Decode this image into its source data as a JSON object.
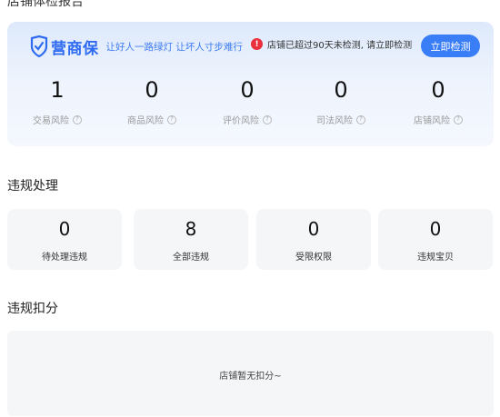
{
  "top_title": "店铺体检报告",
  "risk_panel": {
    "logo_text": "营商保",
    "slogan": "让好人一路绿灯 让坏人寸步难行",
    "alert_text": "店铺已超过90天未检测, 请立即检测",
    "alert_icon": "!",
    "detect_button": "立即检测",
    "items": [
      {
        "value": "1",
        "label": "交易风险"
      },
      {
        "value": "0",
        "label": "商品风险"
      },
      {
        "value": "0",
        "label": "评价风险"
      },
      {
        "value": "0",
        "label": "司法风险"
      },
      {
        "value": "0",
        "label": "店铺风险"
      }
    ],
    "help_icon": "?"
  },
  "violations": {
    "title": "违规处理",
    "stats": [
      {
        "value": "0",
        "label": "待处理违规"
      },
      {
        "value": "8",
        "label": "全部违规"
      },
      {
        "value": "0",
        "label": "受限权限"
      },
      {
        "value": "0",
        "label": "违规宝贝"
      }
    ]
  },
  "deductions": {
    "title": "违规扣分",
    "empty_text": "店铺暂无扣分~"
  },
  "colors": {
    "accent": "#3a7ef7",
    "alert": "#e8313c"
  }
}
